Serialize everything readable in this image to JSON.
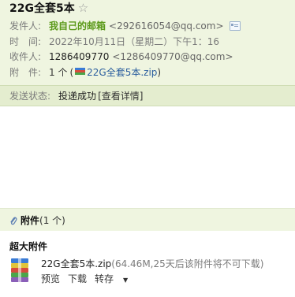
{
  "subject": {
    "title": "22G全套5本",
    "star_icon": "☆"
  },
  "fields": {
    "from_label": "发件人:",
    "from_name": "我自己的邮箱",
    "from_addr": "<292616054@qq.com>",
    "time_label": "时　间:",
    "time_value": "2022年10月11日（星期二）下午1：16",
    "to_label": "收件人:",
    "to_name": "1286409770",
    "to_addr": "<1286409770@qq.com>",
    "attach_label": "附　件:",
    "attach_count": "1 个",
    "attach_paren_open": "(",
    "attach_file": "22G全套5本.zip",
    "attach_paren_close": ")"
  },
  "status": {
    "label": "发送状态:",
    "value": "投递成功",
    "detail_link": "[查看详情]"
  },
  "attachments": {
    "title": "附件",
    "count": "(1 个)",
    "big_label": "超大附件",
    "file": {
      "name": "22G全套5本.zip",
      "meta": "(64.46M,25天后该附件将不可下载)",
      "actions": {
        "preview": "预览",
        "download": "下载",
        "forward": "转存"
      }
    }
  },
  "colors": {
    "header_bg": "#eff5e0",
    "status_bg": "#e4edcf",
    "sender_green": "#5c9a1b"
  }
}
